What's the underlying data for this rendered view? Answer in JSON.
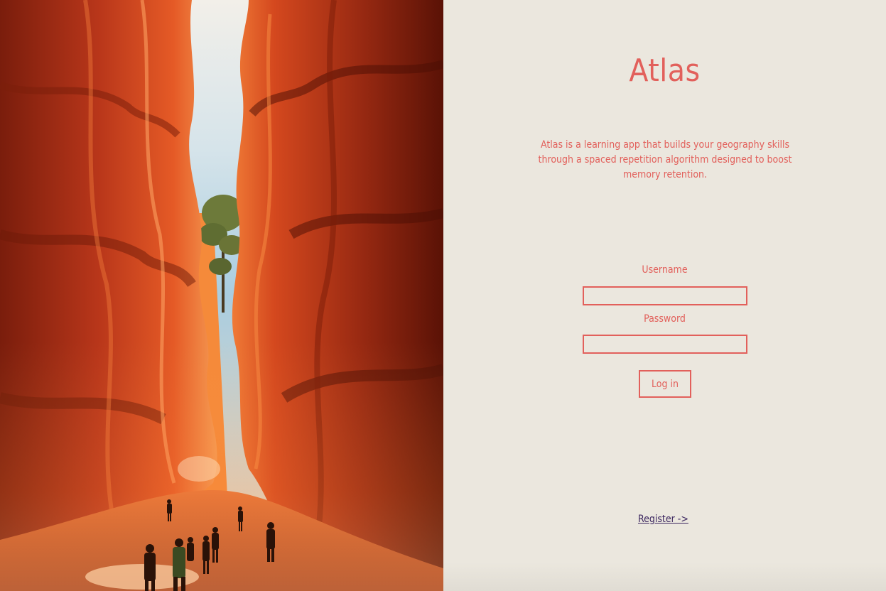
{
  "hero": {
    "image": "canyon-hikers-photo"
  },
  "app": {
    "title": "Atlas",
    "description": "Atlas is a learning app that builds your geography skills through a spaced repetition algorithm designed to boost memory retention."
  },
  "login": {
    "username_label": "Username",
    "username_value": "",
    "password_label": "Password",
    "password_value": "",
    "submit_label": "Log in"
  },
  "register": {
    "link_label": "Register ->"
  },
  "colors": {
    "accent": "#e2605b",
    "panel_background": "#ebe7de",
    "link": "#3d2860"
  }
}
